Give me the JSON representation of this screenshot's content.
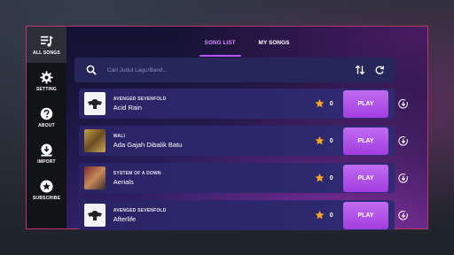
{
  "sidebar": {
    "items": [
      {
        "label": "ALL SONGS",
        "icon": "music-list-icon",
        "active": true
      },
      {
        "label": "SETTING",
        "icon": "gear-icon"
      },
      {
        "label": "ABOUT",
        "icon": "question-icon"
      },
      {
        "label": "IMPORT",
        "icon": "download-icon"
      },
      {
        "label": "SUBSCRIBE",
        "icon": "star-badge-icon"
      }
    ]
  },
  "tabs": [
    {
      "label": "SONG LIST",
      "active": true
    },
    {
      "label": "MY SONGS",
      "active": false
    }
  ],
  "search": {
    "value": "",
    "placeholder": "Cari Judul Lagu/Band..."
  },
  "songs": [
    {
      "artist": "AVENGED SEVENFOLD",
      "title": "Acid Rain",
      "stars": "0",
      "play_label": "PLAY",
      "cover": "a7x"
    },
    {
      "artist": "WALI",
      "title": "Ada Gajah Dibalik Batu",
      "stars": "0",
      "play_label": "PLAY",
      "cover": "wali"
    },
    {
      "artist": "SYSTEM OF A DOWN",
      "title": "Aerials",
      "stars": "0",
      "play_label": "PLAY",
      "cover": "soad"
    },
    {
      "artist": "AVENGED SEVENFOLD",
      "title": "Afterlife",
      "stars": "0",
      "play_label": "PLAY",
      "cover": "a7x"
    }
  ],
  "colors": {
    "accent": "#b855ff",
    "play_button": "#a23ddf",
    "star": "#f5a623",
    "frame_border": "#c0326e"
  }
}
